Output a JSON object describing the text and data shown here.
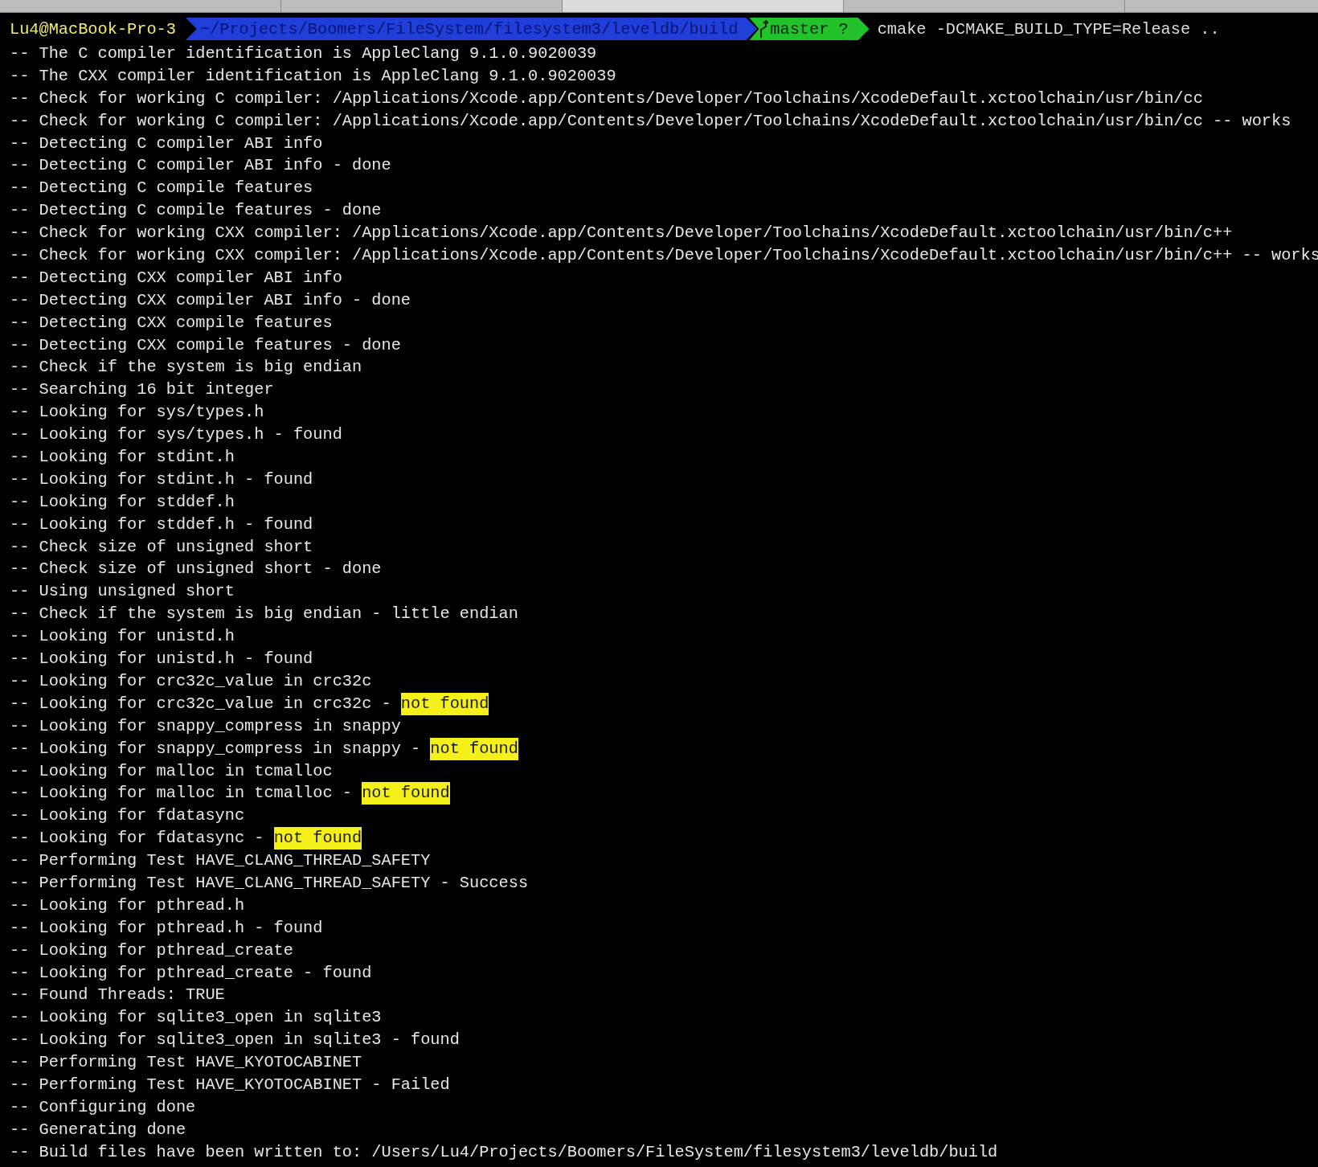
{
  "tabs": [
    {
      "selected": false
    },
    {
      "selected": false
    },
    {
      "selected": true
    },
    {
      "selected": false
    }
  ],
  "prompt": {
    "host": "Lu4@MacBook-Pro-3",
    "path": "~/Projects/Boomers/FileSystem/filesystem3/leveldb/build",
    "branch": "master ?",
    "command": "cmake -DCMAKE_BUILD_TYPE=Release .."
  },
  "output": [
    {
      "text": "-- The C compiler identification is AppleClang 9.1.0.9020039"
    },
    {
      "text": "-- The CXX compiler identification is AppleClang 9.1.0.9020039"
    },
    {
      "text": "-- Check for working C compiler: /Applications/Xcode.app/Contents/Developer/Toolchains/XcodeDefault.xctoolchain/usr/bin/cc"
    },
    {
      "text": "-- Check for working C compiler: /Applications/Xcode.app/Contents/Developer/Toolchains/XcodeDefault.xctoolchain/usr/bin/cc -- works"
    },
    {
      "text": "-- Detecting C compiler ABI info"
    },
    {
      "text": "-- Detecting C compiler ABI info - done"
    },
    {
      "text": "-- Detecting C compile features"
    },
    {
      "text": "-- Detecting C compile features - done"
    },
    {
      "text": "-- Check for working CXX compiler: /Applications/Xcode.app/Contents/Developer/Toolchains/XcodeDefault.xctoolchain/usr/bin/c++"
    },
    {
      "text": "-- Check for working CXX compiler: /Applications/Xcode.app/Contents/Developer/Toolchains/XcodeDefault.xctoolchain/usr/bin/c++ -- works"
    },
    {
      "text": "-- Detecting CXX compiler ABI info"
    },
    {
      "text": "-- Detecting CXX compiler ABI info - done"
    },
    {
      "text": "-- Detecting CXX compile features"
    },
    {
      "text": "-- Detecting CXX compile features - done"
    },
    {
      "text": "-- Check if the system is big endian"
    },
    {
      "text": "-- Searching 16 bit integer"
    },
    {
      "text": "-- Looking for sys/types.h"
    },
    {
      "text": "-- Looking for sys/types.h - found"
    },
    {
      "text": "-- Looking for stdint.h"
    },
    {
      "text": "-- Looking for stdint.h - found"
    },
    {
      "text": "-- Looking for stddef.h"
    },
    {
      "text": "-- Looking for stddef.h - found"
    },
    {
      "text": "-- Check size of unsigned short"
    },
    {
      "text": "-- Check size of unsigned short - done"
    },
    {
      "text": "-- Using unsigned short"
    },
    {
      "text": "-- Check if the system is big endian - little endian"
    },
    {
      "text": "-- Looking for unistd.h"
    },
    {
      "text": "-- Looking for unistd.h - found"
    },
    {
      "text": "-- Looking for crc32c_value in crc32c"
    },
    {
      "text": "-- Looking for crc32c_value in crc32c - ",
      "highlight": "not found"
    },
    {
      "text": "-- Looking for snappy_compress in snappy"
    },
    {
      "text": "-- Looking for snappy_compress in snappy - ",
      "highlight": "not found"
    },
    {
      "text": "-- Looking for malloc in tcmalloc"
    },
    {
      "text": "-- Looking for malloc in tcmalloc - ",
      "highlight": "not found"
    },
    {
      "text": "-- Looking for fdatasync"
    },
    {
      "text": "-- Looking for fdatasync - ",
      "highlight": "not found"
    },
    {
      "text": "-- Performing Test HAVE_CLANG_THREAD_SAFETY"
    },
    {
      "text": "-- Performing Test HAVE_CLANG_THREAD_SAFETY - Success"
    },
    {
      "text": "-- Looking for pthread.h"
    },
    {
      "text": "-- Looking for pthread.h - found"
    },
    {
      "text": "-- Looking for pthread_create"
    },
    {
      "text": "-- Looking for pthread_create - found"
    },
    {
      "text": "-- Found Threads: TRUE"
    },
    {
      "text": "-- Looking for sqlite3_open in sqlite3"
    },
    {
      "text": "-- Looking for sqlite3_open in sqlite3 - found"
    },
    {
      "text": "-- Performing Test HAVE_KYOTOCABINET"
    },
    {
      "text": "-- Performing Test HAVE_KYOTOCABINET - Failed"
    },
    {
      "text": "-- Configuring done"
    },
    {
      "text": "-- Generating done"
    },
    {
      "text": "-- Build files have been written to: /Users/Lu4/Projects/Boomers/FileSystem/filesystem3/leveldb/build"
    }
  ]
}
